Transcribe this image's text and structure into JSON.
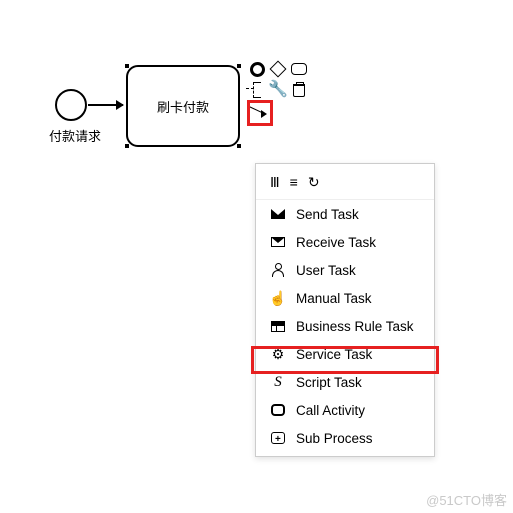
{
  "start_event": {
    "label": "付款请求"
  },
  "task": {
    "label": "刷卡付款"
  },
  "context_pad": {
    "row1": [
      "end-event",
      "gateway",
      "task-shape"
    ],
    "row2": [
      "annotation",
      "wrench",
      "trash"
    ],
    "row3": [
      "sequence-flow"
    ]
  },
  "menu": {
    "header_icons": [
      "parallel",
      "list",
      "loop"
    ],
    "items": [
      {
        "icon": "mail-filled",
        "label": "Send Task"
      },
      {
        "icon": "mail-outline",
        "label": "Receive Task"
      },
      {
        "icon": "user",
        "label": "User Task"
      },
      {
        "icon": "hand",
        "label": "Manual Task"
      },
      {
        "icon": "table",
        "label": "Business Rule Task"
      },
      {
        "icon": "gear",
        "label": "Service Task"
      },
      {
        "icon": "script",
        "label": "Script Task"
      },
      {
        "icon": "call",
        "label": "Call Activity"
      },
      {
        "icon": "sub",
        "label": "Sub Process"
      }
    ]
  },
  "highlight": {
    "wrench": true,
    "menu_item": "Service Task",
    "color": "#e62020"
  },
  "watermark": "@51CTO博客"
}
